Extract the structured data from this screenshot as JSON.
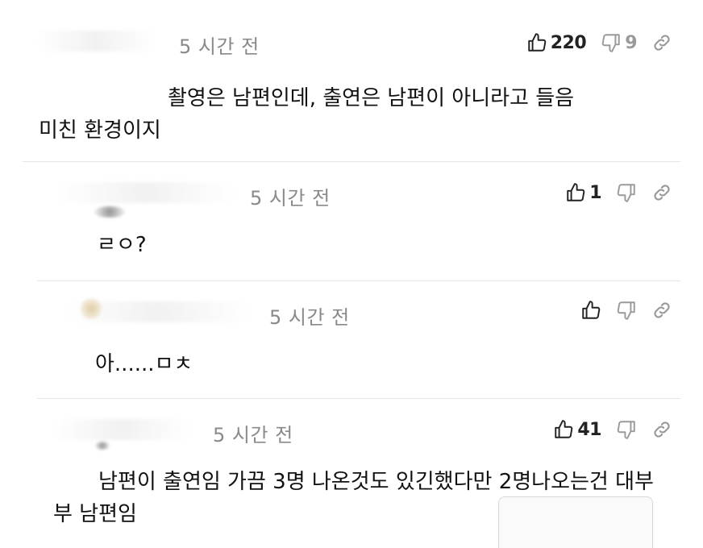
{
  "comments": [
    {
      "timestamp": "5 시간 전",
      "likes": "220",
      "dislikes": "9",
      "body_lines": [
        "촬영은 남편인데, 출연은 남편이 아니라고 들음",
        "미친 환경이지"
      ]
    },
    {
      "timestamp": "5 시간 전",
      "likes": "1",
      "dislikes": "",
      "body_lines": [
        "ㄹㅇ?"
      ]
    },
    {
      "timestamp": "5 시간 전",
      "likes": "",
      "dislikes": "",
      "body_lines": [
        "아......ㅁㅊ"
      ]
    },
    {
      "timestamp": "5 시간 전",
      "likes": "41",
      "dislikes": "",
      "body_lines": [
        "남편이 출연임 가끔 3명 나온것도 있긴했다만 2명나오는건 대부",
        "부 남편임"
      ]
    }
  ],
  "icons": {
    "like": "thumbs-up-icon",
    "dislike": "thumbs-down-icon",
    "share": "link-icon"
  },
  "colors": {
    "text": "#111111",
    "muted": "#8a8a8a",
    "count": "#222222",
    "divider": "#e6e6e6"
  }
}
